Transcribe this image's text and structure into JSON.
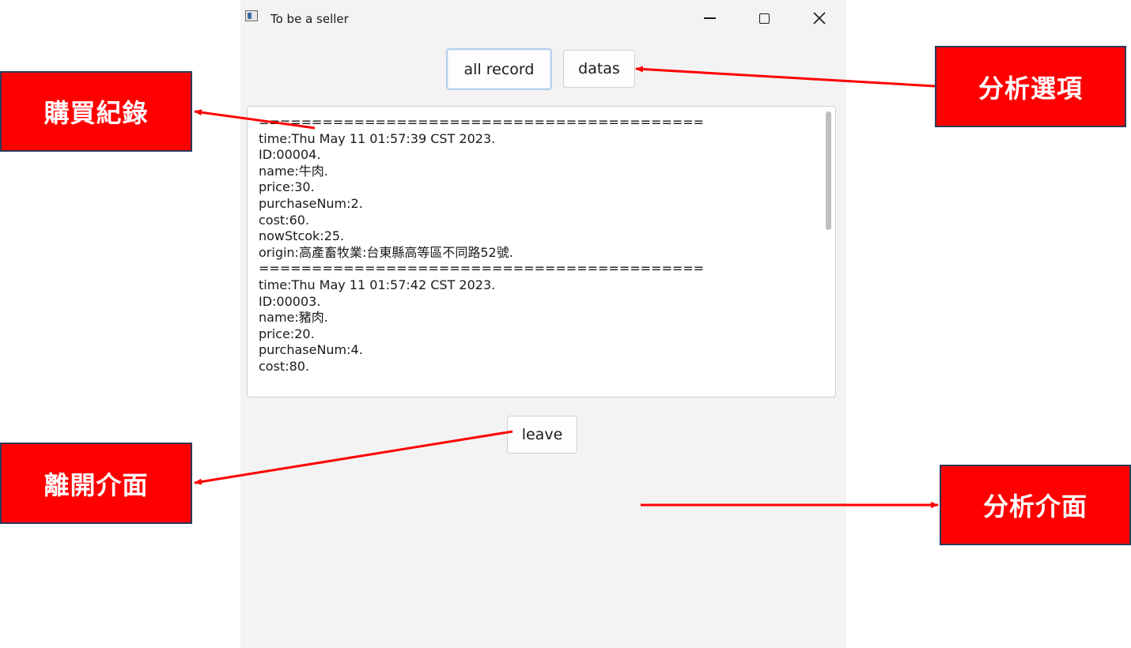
{
  "window": {
    "title": "To be a seller",
    "controls": {
      "minimize": "minimize-icon",
      "maximize": "maximize-icon",
      "close": "close-icon"
    }
  },
  "toolbar": {
    "all_record_label": "all record",
    "datas_label": "datas"
  },
  "records": {
    "lines": [
      "==========================================",
      "time:Thu May 11 01:57:39 CST 2023.",
      "ID:00004.",
      "name:牛肉.",
      "price:30.",
      "purchaseNum:2.",
      "cost:60.",
      "nowStcok:25.",
      "origin:高產畜牧業:台東縣高等區不同路52號.",
      "==========================================",
      "time:Thu May 11 01:57:42 CST 2023.",
      "ID:00003.",
      "name:豬肉.",
      "price:20.",
      "purchaseNum:4.",
      "cost:80."
    ]
  },
  "footer": {
    "leave_label": "leave"
  },
  "annotations": {
    "purchase_record": "購買紀錄",
    "analysis_options": "分析選項",
    "leave_interface": "離開介面",
    "analysis_interface": "分析介面",
    "color": "#ff0000"
  }
}
